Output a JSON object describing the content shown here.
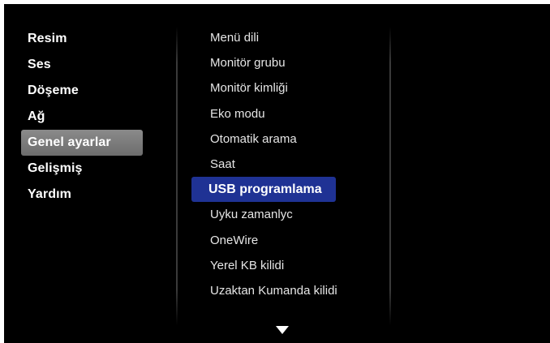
{
  "left_menu": {
    "items": [
      {
        "label": "Resim"
      },
      {
        "label": "Ses"
      },
      {
        "label": "Döşeme"
      },
      {
        "label": "Ağ"
      },
      {
        "label": "Genel ayarlar"
      },
      {
        "label": "Gelişmiş"
      },
      {
        "label": "Yardım"
      }
    ],
    "selected": "Genel ayarlar"
  },
  "right_menu": {
    "items": [
      {
        "label": "Menü dili"
      },
      {
        "label": "Monitör grubu"
      },
      {
        "label": "Monitör kimliği"
      },
      {
        "label": "Eko modu"
      },
      {
        "label": "Otomatik arama"
      },
      {
        "label": "Saat"
      },
      {
        "label": "USB programlama"
      },
      {
        "label": "Uyku zamanlyc"
      },
      {
        "label": "OneWire"
      },
      {
        "label": "Yerel KB kilidi"
      },
      {
        "label": "Uzaktan Kumanda kilidi"
      }
    ],
    "focused": "USB programlama"
  },
  "icons": {
    "scroll_down": "chevron-down-icon"
  },
  "colors": {
    "background": "#000000",
    "focus_highlight": "#1f3294",
    "selected_category": "#7a7a7a",
    "text": "#ffffff"
  }
}
